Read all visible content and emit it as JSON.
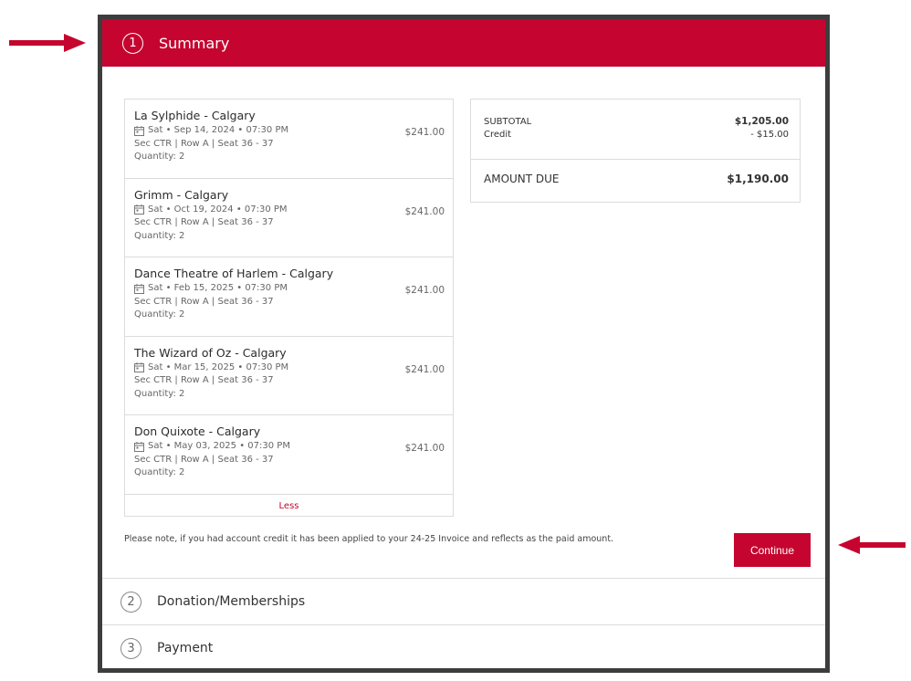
{
  "colors": {
    "brand": "#c5052f",
    "frame": "#3d3d3d"
  },
  "summary_step": {
    "number": "1",
    "title": "Summary"
  },
  "orders": [
    {
      "title": "La Sylphide - Calgary",
      "date": "Sat • Sep 14, 2024 • 07:30 PM",
      "seat": "Sec CTR | Row A  |  Seat 36 - 37",
      "quantity": "Quantity: 2",
      "price": "$241.00"
    },
    {
      "title": "Grimm - Calgary",
      "date": "Sat • Oct 19, 2024 • 07:30 PM",
      "seat": "Sec CTR | Row A  |  Seat 36 - 37",
      "quantity": "Quantity: 2",
      "price": "$241.00"
    },
    {
      "title": "Dance Theatre of Harlem - Calgary",
      "date": "Sat • Feb 15, 2025 • 07:30 PM",
      "seat": "Sec CTR | Row A  |  Seat 36 - 37",
      "quantity": "Quantity: 2",
      "price": "$241.00"
    },
    {
      "title": "The Wizard of Oz - Calgary",
      "date": "Sat • Mar 15, 2025 • 07:30 PM",
      "seat": "Sec CTR | Row A  |  Seat 36 - 37",
      "quantity": "Quantity: 2",
      "price": "$241.00"
    },
    {
      "title": "Don Quixote - Calgary",
      "date": "Sat • May 03, 2025 • 07:30 PM",
      "seat": "Sec CTR | Row A  |  Seat 36 - 37",
      "quantity": "Quantity: 2",
      "price": "$241.00"
    }
  ],
  "less_label": "Less",
  "totals": {
    "subtotal_label": "SUBTOTAL",
    "subtotal_value": "$1,205.00",
    "credit_label": "Credit",
    "credit_value": "- $15.00",
    "amount_due_label": "AMOUNT DUE",
    "amount_due_value": "$1,190.00"
  },
  "note": "Please note, if you had account credit it has been applied to your 24-25 Invoice and reflects as the paid amount.",
  "continue_label": "Continue",
  "steps": [
    {
      "number": "2",
      "title": "Donation/Memberships"
    },
    {
      "number": "3",
      "title": "Payment"
    }
  ],
  "icons": {
    "arrow": "arrow-icon",
    "calendar": "calendar-icon"
  }
}
